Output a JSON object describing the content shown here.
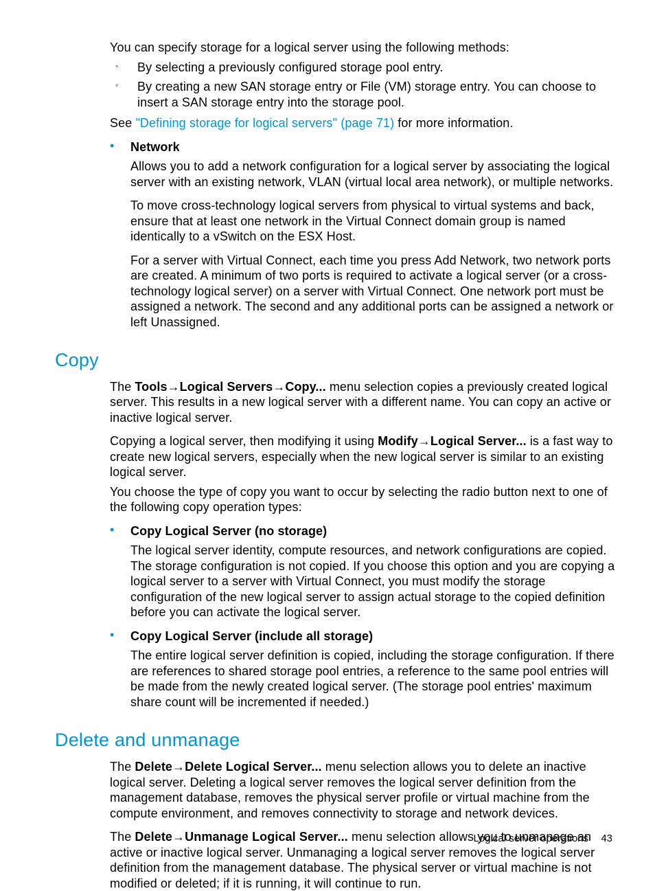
{
  "intro_para": "You can specify storage for a logical server using the following methods:",
  "intro_bullets": [
    "By selecting a previously configured storage pool entry.",
    "By creating a new SAN storage entry or File (VM) storage entry. You can choose to insert a SAN storage entry into the storage pool."
  ],
  "see_pre": "See ",
  "see_link": "\"Defining storage for logical servers\" (page 71)",
  "see_post": " for more information.",
  "network": {
    "title": "Network",
    "p1": "Allows you to add a network configuration for a logical server by associating the logical server with an existing network, VLAN (virtual local area network), or multiple networks.",
    "p2": "To move cross-technology logical servers from physical to virtual systems and back, ensure that at least one network in the Virtual Connect domain group is named identically to a vSwitch on the ESX Host.",
    "p3": "For a server with Virtual Connect, each time you press Add Network, two network ports are created. A minimum of two ports is required to activate a logical server (or a cross-technology logical server) on a server with Virtual Connect. One network port must be assigned a network. The second and any additional ports can be assigned a network or left Unassigned."
  },
  "copy": {
    "heading": "Copy",
    "p1_pre": "The ",
    "p1_bold": "Tools→Logical Servers→Copy...",
    "p1_post": " menu selection copies a previously created logical server. This results in a new logical server with a different name. You can copy an active or inactive logical server.",
    "p2_pre": "Copying a logical server, then modifying it using ",
    "p2_bold": "Modify→Logical Server...",
    "p2_post": " is a fast way to create new logical servers, especially when the new logical server is similar to an existing logical server.",
    "p3": "You choose the type of copy you want to occur by selecting the radio button next to one of the following copy operation types:",
    "items": [
      {
        "title": "Copy Logical Server (no storage)",
        "body": "The logical server identity, compute resources, and network configurations are copied. The storage configuration is not copied. If you choose this option and you are copying a logical server to a server with Virtual Connect, you must modify the storage configuration of the new logical server to assign actual storage to the copied definition before you can activate the logical server."
      },
      {
        "title": "Copy Logical Server (include all storage)",
        "body": "The entire logical server definition is copied, including the storage configuration. If there are references to shared storage pool entries, a reference to the same pool entries will be made from the newly created logical server. (The storage pool entries' maximum share count will be incremented if needed.)"
      }
    ]
  },
  "delete": {
    "heading": "Delete and unmanage",
    "p1_pre": "The ",
    "p1_bold": "Delete→Delete Logical Server...",
    "p1_post": " menu selection allows you to delete an inactive logical server. Deleting a logical server removes the logical server definition from the management database, removes the physical server profile or virtual machine from the compute environment, and removes connectivity to storage and network devices.",
    "p2_pre": "The ",
    "p2_bold": "Delete→Unmanage Logical Server...",
    "p2_post": " menu selection allows you to unmanage an active or inactive logical server. Unmanaging a logical server removes the logical server definition from the management database. The physical server or virtual machine is not modified or deleted; if it is running, it will continue to run."
  },
  "footer": {
    "label": "Logical server operations",
    "page": "43"
  }
}
